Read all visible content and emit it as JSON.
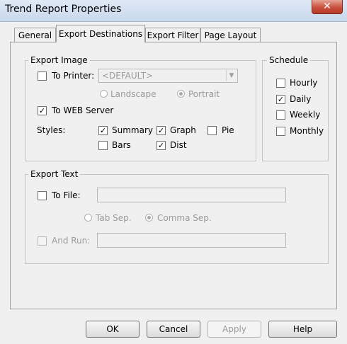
{
  "window": {
    "title": "Trend Report Properties",
    "close_symbol": "✕"
  },
  "tabs": [
    {
      "label": "General"
    },
    {
      "label": "Export Destinations"
    },
    {
      "label": "Export Filter"
    },
    {
      "label": "Page Layout"
    }
  ],
  "export_image": {
    "legend": "Export Image",
    "to_printer": {
      "label": "To Printer:",
      "checked": false,
      "check": ""
    },
    "printer_select": {
      "value": "<DEFAULT>",
      "arrow": "▼"
    },
    "landscape": {
      "label": "Landscape",
      "selected": false
    },
    "portrait": {
      "label": "Portrait",
      "selected": true
    },
    "to_web_server": {
      "label": "To WEB Server",
      "checked": true,
      "check": "✓"
    },
    "styles_label": "Styles:",
    "styles": {
      "summary": {
        "label": "Summary",
        "checked": true,
        "check": "✓"
      },
      "graph": {
        "label": "Graph",
        "checked": true,
        "check": "✓"
      },
      "pie": {
        "label": "Pie",
        "checked": false,
        "check": ""
      },
      "bars": {
        "label": "Bars",
        "checked": false,
        "check": ""
      },
      "dist": {
        "label": "Dist",
        "checked": true,
        "check": "✓"
      }
    }
  },
  "schedule": {
    "legend": "Schedule",
    "hourly": {
      "label": "Hourly",
      "checked": false,
      "check": ""
    },
    "daily": {
      "label": "Daily",
      "checked": true,
      "check": "✓"
    },
    "weekly": {
      "label": "Weekly",
      "checked": false,
      "check": ""
    },
    "monthly": {
      "label": "Monthly",
      "checked": false,
      "check": ""
    }
  },
  "export_text": {
    "legend": "Export Text",
    "to_file": {
      "label": "To File:",
      "checked": false,
      "check": "",
      "value": ""
    },
    "tab_sep": {
      "label": "Tab Sep.",
      "selected": false
    },
    "comma_sep": {
      "label": "Comma Sep.",
      "selected": true
    },
    "and_run": {
      "label": "And Run:",
      "checked": false,
      "check": "",
      "value": ""
    }
  },
  "buttons": {
    "ok": "OK",
    "cancel": "Cancel",
    "apply": "Apply",
    "help": "Help"
  }
}
